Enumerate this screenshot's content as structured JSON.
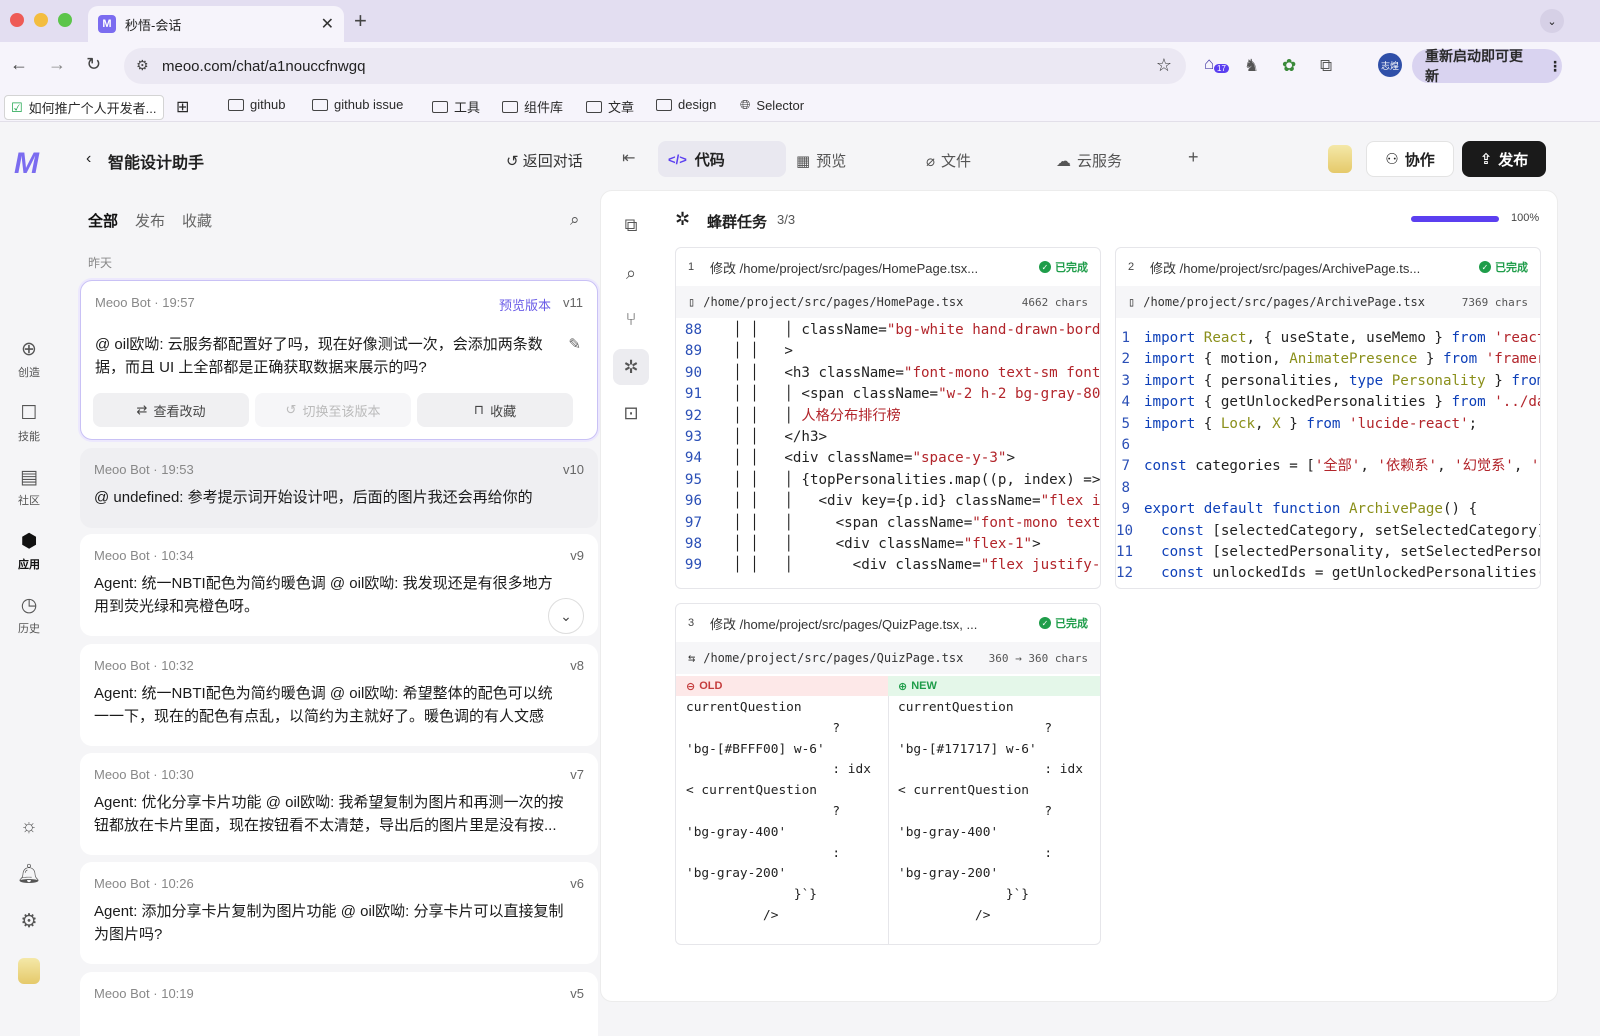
{
  "browser": {
    "tab_title": "秒悟-会话",
    "tab_favicon": "M",
    "url": "meoo.com/chat/a1nouccfnwgq",
    "profile_label": "志煌",
    "update_label": "重新启动即可更新",
    "ext_badge": "17",
    "bookmarks": [
      "如何推广个人开发者...",
      "github",
      "github issue",
      "工具",
      "组件库",
      "文章",
      "design",
      "Selector"
    ]
  },
  "rail": {
    "items": [
      {
        "label": "创造",
        "icon": "plus-circle-icon"
      },
      {
        "label": "技能",
        "icon": "skill-icon"
      },
      {
        "label": "社区",
        "icon": "grid-icon"
      },
      {
        "label": "应用",
        "icon": "cube-icon"
      },
      {
        "label": "历史",
        "icon": "clock-icon"
      }
    ]
  },
  "chat": {
    "title": "智能设计助手",
    "return_label": "返回对话",
    "filters": [
      "全部",
      "发布",
      "收藏"
    ],
    "day_label": "昨天",
    "messages": [
      {
        "author": "Meoo Bot",
        "time": "19:57",
        "version": "v11",
        "badge": "预览版本",
        "text": "@ oil欧呦: 云服务都配置好了吗，现在好像测试一次，会添加两条数据，而且 UI 上全部都是正确获取数据来展示的吗?",
        "actions": [
          "查看改动",
          "切换至该版本",
          "收藏"
        ]
      },
      {
        "author": "Meoo Bot",
        "time": "19:53",
        "version": "v10",
        "text": "@ undefined: 参考提示词开始设计吧，后面的图片我还会再给你的"
      },
      {
        "author": "Meoo Bot",
        "time": "10:34",
        "version": "v9",
        "text": "Agent: 统一NBTI配色为简约暖色调 @ oil欧呦: 我发现还是有很多地方用到荧光绿和亮橙色呀。"
      },
      {
        "author": "Meoo Bot",
        "time": "10:32",
        "version": "v8",
        "text": "Agent: 统一NBTI配色为简约暖色调 @ oil欧呦: 希望整体的配色可以统一一下，现在的配色有点乱，以简约为主就好了。暖色调的有人文感"
      },
      {
        "author": "Meoo Bot",
        "time": "10:30",
        "version": "v7",
        "text": "Agent: 优化分享卡片功能 @ oil欧呦: 我希望复制为图片和再测一次的按钮都放在卡片里面，现在按钮看不太清楚，导出后的图片里是没有按..."
      },
      {
        "author": "Meoo Bot",
        "time": "10:26",
        "version": "v6",
        "text": "Agent: 添加分享卡片复制为图片功能 @ oil欧呦: 分享卡片可以直接复制为图片吗?"
      },
      {
        "author": "Meoo Bot",
        "time": "10:19",
        "version": "v5",
        "text": ""
      }
    ]
  },
  "workspace": {
    "tabs": [
      "代码",
      "预览",
      "文件",
      "云服务"
    ],
    "collab_label": "协作",
    "publish_label": "发布",
    "swarm_title": "蜂群任务",
    "swarm_count": "3/3",
    "progress": 100,
    "progress_label": "100%",
    "done_label": "已完成",
    "tasks": [
      {
        "num": "1",
        "title": "修改 /home/project/src/pages/HomePage.tsx...",
        "file": "/home/project/src/pages/HomePage.tsx",
        "chars": "4662 chars"
      },
      {
        "num": "2",
        "title": "修改 /home/project/src/pages/ArchivePage.ts...",
        "file": "/home/project/src/pages/ArchivePage.tsx",
        "chars": "7369 chars"
      },
      {
        "num": "3",
        "title": "修改 /home/project/src/pages/QuizPage.tsx, ...",
        "file": "/home/project/src/pages/QuizPage.tsx",
        "chars": "360 → 360 chars"
      }
    ],
    "diff": {
      "old_label": "OLD",
      "new_label": "NEW",
      "old_color": "#BFFF00",
      "new_color": "#171717"
    }
  },
  "colors": {
    "accent": "#5b3ff0",
    "success": "#1f9d4a"
  }
}
